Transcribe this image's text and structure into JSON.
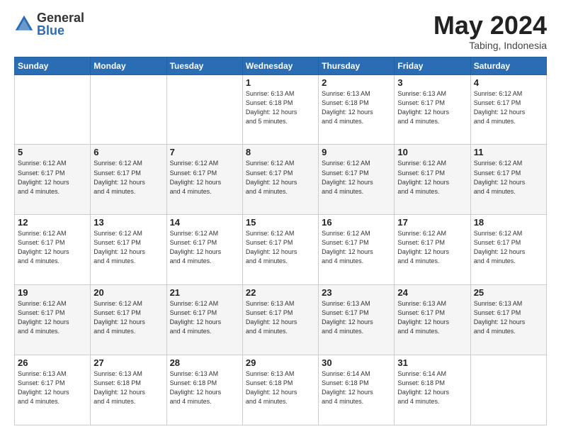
{
  "logo": {
    "general": "General",
    "blue": "Blue"
  },
  "header": {
    "month": "May 2024",
    "location": "Tabing, Indonesia"
  },
  "weekdays": [
    "Sunday",
    "Monday",
    "Tuesday",
    "Wednesday",
    "Thursday",
    "Friday",
    "Saturday"
  ],
  "weeks": [
    [
      {
        "day": "",
        "info": ""
      },
      {
        "day": "",
        "info": ""
      },
      {
        "day": "",
        "info": ""
      },
      {
        "day": "1",
        "info": "Sunrise: 6:13 AM\nSunset: 6:18 PM\nDaylight: 12 hours\nand 5 minutes."
      },
      {
        "day": "2",
        "info": "Sunrise: 6:13 AM\nSunset: 6:18 PM\nDaylight: 12 hours\nand 4 minutes."
      },
      {
        "day": "3",
        "info": "Sunrise: 6:13 AM\nSunset: 6:17 PM\nDaylight: 12 hours\nand 4 minutes."
      },
      {
        "day": "4",
        "info": "Sunrise: 6:12 AM\nSunset: 6:17 PM\nDaylight: 12 hours\nand 4 minutes."
      }
    ],
    [
      {
        "day": "5",
        "info": "Sunrise: 6:12 AM\nSunset: 6:17 PM\nDaylight: 12 hours\nand 4 minutes."
      },
      {
        "day": "6",
        "info": "Sunrise: 6:12 AM\nSunset: 6:17 PM\nDaylight: 12 hours\nand 4 minutes."
      },
      {
        "day": "7",
        "info": "Sunrise: 6:12 AM\nSunset: 6:17 PM\nDaylight: 12 hours\nand 4 minutes."
      },
      {
        "day": "8",
        "info": "Sunrise: 6:12 AM\nSunset: 6:17 PM\nDaylight: 12 hours\nand 4 minutes."
      },
      {
        "day": "9",
        "info": "Sunrise: 6:12 AM\nSunset: 6:17 PM\nDaylight: 12 hours\nand 4 minutes."
      },
      {
        "day": "10",
        "info": "Sunrise: 6:12 AM\nSunset: 6:17 PM\nDaylight: 12 hours\nand 4 minutes."
      },
      {
        "day": "11",
        "info": "Sunrise: 6:12 AM\nSunset: 6:17 PM\nDaylight: 12 hours\nand 4 minutes."
      }
    ],
    [
      {
        "day": "12",
        "info": "Sunrise: 6:12 AM\nSunset: 6:17 PM\nDaylight: 12 hours\nand 4 minutes."
      },
      {
        "day": "13",
        "info": "Sunrise: 6:12 AM\nSunset: 6:17 PM\nDaylight: 12 hours\nand 4 minutes."
      },
      {
        "day": "14",
        "info": "Sunrise: 6:12 AM\nSunset: 6:17 PM\nDaylight: 12 hours\nand 4 minutes."
      },
      {
        "day": "15",
        "info": "Sunrise: 6:12 AM\nSunset: 6:17 PM\nDaylight: 12 hours\nand 4 minutes."
      },
      {
        "day": "16",
        "info": "Sunrise: 6:12 AM\nSunset: 6:17 PM\nDaylight: 12 hours\nand 4 minutes."
      },
      {
        "day": "17",
        "info": "Sunrise: 6:12 AM\nSunset: 6:17 PM\nDaylight: 12 hours\nand 4 minutes."
      },
      {
        "day": "18",
        "info": "Sunrise: 6:12 AM\nSunset: 6:17 PM\nDaylight: 12 hours\nand 4 minutes."
      }
    ],
    [
      {
        "day": "19",
        "info": "Sunrise: 6:12 AM\nSunset: 6:17 PM\nDaylight: 12 hours\nand 4 minutes."
      },
      {
        "day": "20",
        "info": "Sunrise: 6:12 AM\nSunset: 6:17 PM\nDaylight: 12 hours\nand 4 minutes."
      },
      {
        "day": "21",
        "info": "Sunrise: 6:12 AM\nSunset: 6:17 PM\nDaylight: 12 hours\nand 4 minutes."
      },
      {
        "day": "22",
        "info": "Sunrise: 6:13 AM\nSunset: 6:17 PM\nDaylight: 12 hours\nand 4 minutes."
      },
      {
        "day": "23",
        "info": "Sunrise: 6:13 AM\nSunset: 6:17 PM\nDaylight: 12 hours\nand 4 minutes."
      },
      {
        "day": "24",
        "info": "Sunrise: 6:13 AM\nSunset: 6:17 PM\nDaylight: 12 hours\nand 4 minutes."
      },
      {
        "day": "25",
        "info": "Sunrise: 6:13 AM\nSunset: 6:17 PM\nDaylight: 12 hours\nand 4 minutes."
      }
    ],
    [
      {
        "day": "26",
        "info": "Sunrise: 6:13 AM\nSunset: 6:17 PM\nDaylight: 12 hours\nand 4 minutes."
      },
      {
        "day": "27",
        "info": "Sunrise: 6:13 AM\nSunset: 6:18 PM\nDaylight: 12 hours\nand 4 minutes."
      },
      {
        "day": "28",
        "info": "Sunrise: 6:13 AM\nSunset: 6:18 PM\nDaylight: 12 hours\nand 4 minutes."
      },
      {
        "day": "29",
        "info": "Sunrise: 6:13 AM\nSunset: 6:18 PM\nDaylight: 12 hours\nand 4 minutes."
      },
      {
        "day": "30",
        "info": "Sunrise: 6:14 AM\nSunset: 6:18 PM\nDaylight: 12 hours\nand 4 minutes."
      },
      {
        "day": "31",
        "info": "Sunrise: 6:14 AM\nSunset: 6:18 PM\nDaylight: 12 hours\nand 4 minutes."
      },
      {
        "day": "",
        "info": ""
      }
    ]
  ]
}
